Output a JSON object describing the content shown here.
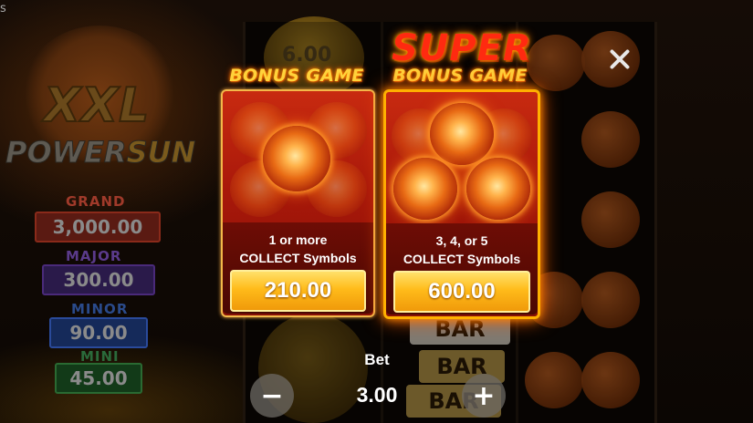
{
  "corner_glyph": "s",
  "logo": {
    "line1": "XXL",
    "line2_a": "POWER",
    "line2_b": "SUN"
  },
  "jackpots": [
    {
      "name": "GRAND",
      "value": "3,000.00",
      "color": "#c0392b"
    },
    {
      "name": "MAJOR",
      "value": "300.00",
      "color": "#6a3aa8"
    },
    {
      "name": "MINOR",
      "value": "90.00",
      "color": "#2f62c8"
    },
    {
      "name": "MINI",
      "value": "45.00",
      "color": "#2a9a3a"
    }
  ],
  "reel_symbols": {
    "coin_value": "6.00",
    "bar_1": "BAR",
    "bar_2": "BAR",
    "bar_3": "BAR"
  },
  "bonus_game": {
    "title": "BONUS GAME",
    "line1": "1 or more",
    "line2": "COLLECT Symbols",
    "price": "210.00"
  },
  "super_bonus_game": {
    "title_top": "SUPER",
    "title": "BONUS GAME",
    "line1": "3, 4, or 5",
    "line2": "COLLECT Symbols",
    "price": "600.00"
  },
  "bet": {
    "label": "Bet",
    "value": "3.00",
    "decrease": "−",
    "increase": "+"
  },
  "colors": {
    "panel_red": "#b81e0c",
    "price_gold": "#ffbb1a",
    "title_gold": "#ffd23a",
    "super_red": "#ff2a10"
  }
}
